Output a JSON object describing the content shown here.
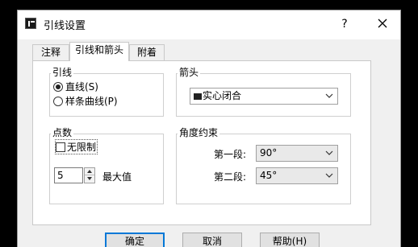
{
  "window": {
    "title": "引线设置",
    "help_label": "?"
  },
  "tabs": [
    {
      "label": "注释"
    },
    {
      "label": "引线和箭头"
    },
    {
      "label": "附着"
    }
  ],
  "leader": {
    "title": "引线",
    "options": [
      {
        "label": "直线(S)",
        "selected": true
      },
      {
        "label": "样条曲线(P)",
        "selected": false
      }
    ]
  },
  "arrowhead": {
    "title": "箭头",
    "value": "实心闭合"
  },
  "points": {
    "title": "点数",
    "unlimited_label": "无限制",
    "unlimited_checked": false,
    "max_value": "5",
    "max_label": "最大值"
  },
  "angle": {
    "title": "角度约束",
    "first_label": "第一段:",
    "first_value": "90°",
    "second_label": "第二段:",
    "second_value": "45°"
  },
  "buttons": {
    "ok": "确定",
    "cancel": "取消",
    "help": "帮助(H)"
  }
}
